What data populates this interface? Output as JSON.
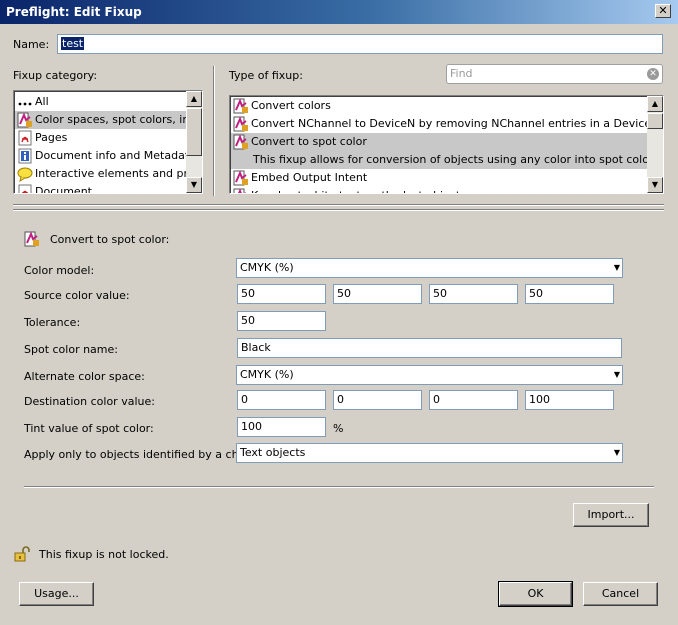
{
  "window": {
    "title": "Preflight: Edit Fixup",
    "close_glyph": "✕"
  },
  "name": {
    "label": "Name:",
    "value": "test"
  },
  "category": {
    "label": "Fixup category:",
    "items": [
      {
        "icon": "dots-icon",
        "label": "All"
      },
      {
        "icon": "color-icon",
        "label": "Color spaces, spot colors, inks",
        "selected": true
      },
      {
        "icon": "pdf-icon",
        "label": "Pages"
      },
      {
        "icon": "info-doc-icon",
        "label": "Document info and Metadata"
      },
      {
        "icon": "comment-icon",
        "label": "Interactive elements and prope"
      },
      {
        "icon": "pdf-icon",
        "label": "Document"
      }
    ]
  },
  "type": {
    "label": "Type of fixup:",
    "find_placeholder": "Find",
    "items": [
      {
        "icon": "fixup-icon",
        "label": "Convert colors"
      },
      {
        "icon": "fixup-icon",
        "label": "Convert NChannel to DeviceN by removing NChannel entries in a DeviceN color spa"
      },
      {
        "icon": "fixup-icon",
        "label": "Convert to spot color",
        "selected": true
      },
      {
        "icon": "",
        "label": "This fixup allows for conversion of objects using any color into spot color objects.",
        "selected": true,
        "desc": true
      },
      {
        "icon": "fixup-icon",
        "label": "Embed Output Intent"
      },
      {
        "icon": "fixup-icon",
        "label": "Knockout white text on the last object"
      }
    ]
  },
  "details": {
    "heading": "Convert to spot color:",
    "color_model": {
      "label": "Color model:",
      "value": "CMYK (%)"
    },
    "source_color": {
      "label": "Source color value:",
      "values": [
        "50",
        "50",
        "50",
        "50"
      ]
    },
    "tolerance": {
      "label": "Tolerance:",
      "value": "50"
    },
    "spot_name": {
      "label": "Spot color name:",
      "value": "Black"
    },
    "alt_space": {
      "label": "Alternate color space:",
      "value": "CMYK (%)"
    },
    "dest_color": {
      "label": "Destination color value:",
      "values": [
        "0",
        "0",
        "0",
        "100"
      ]
    },
    "tint": {
      "label": "Tint value of spot color:",
      "value": "100",
      "unit": "%"
    },
    "apply": {
      "label": "Apply only to objects identified by a check:",
      "value": "Text objects"
    }
  },
  "buttons": {
    "import": "Import...",
    "usage": "Usage...",
    "ok": "OK",
    "cancel": "Cancel"
  },
  "lock": {
    "text": "This fixup is not locked."
  }
}
